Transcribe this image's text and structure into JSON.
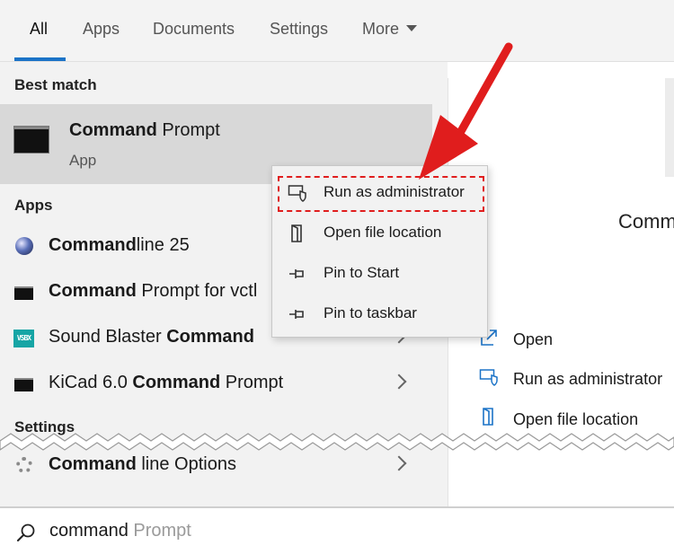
{
  "tabs": [
    {
      "label": "All",
      "active": true
    },
    {
      "label": "Apps"
    },
    {
      "label": "Documents"
    },
    {
      "label": "Settings"
    },
    {
      "label": "More"
    }
  ],
  "left": {
    "best_match_title": "Best match",
    "best_match": {
      "title_bold": "Command",
      "title_rest": " Prompt",
      "subtitle": "App",
      "icon": "command-prompt-icon"
    },
    "apps_title": "Apps",
    "apps": [
      {
        "bold": "Command",
        "rest": "line 25",
        "pre": "",
        "icon": "commandline-globe-icon"
      },
      {
        "bold": "Command",
        "rest": " Prompt for vctl",
        "pre": "",
        "icon": "command-prompt-icon"
      },
      {
        "pre": "Sound Blaster ",
        "bold": "Command",
        "rest": "",
        "icon": "sound-blaster-icon"
      },
      {
        "pre": "KiCad 6.0 ",
        "bold": "Command",
        "rest": " Prompt",
        "icon": "command-prompt-icon"
      }
    ],
    "settings_title": "Settings",
    "settings": [
      {
        "bold": "Command",
        "rest": " line Options",
        "icon": "gear-icon"
      }
    ]
  },
  "right": {
    "title": "Comm",
    "actions": [
      {
        "label": "Open",
        "icon": "open-icon"
      },
      {
        "label": "Run as administrator",
        "icon": "shield-icon"
      },
      {
        "label": "Open file location",
        "icon": "folder-icon"
      }
    ]
  },
  "context_menu": {
    "items": [
      {
        "label": "Run as administrator",
        "icon": "shield-icon"
      },
      {
        "label": "Open file location",
        "icon": "folder-icon"
      },
      {
        "label": "Pin to Start",
        "icon": "pin-icon"
      },
      {
        "label": "Pin to taskbar",
        "icon": "pin-icon"
      }
    ]
  },
  "search": {
    "typed": "command",
    "suggestion": " Prompt",
    "icon": "search-icon"
  },
  "colors": {
    "accent": "#1b73c7",
    "highlight": "#e01d1d"
  }
}
